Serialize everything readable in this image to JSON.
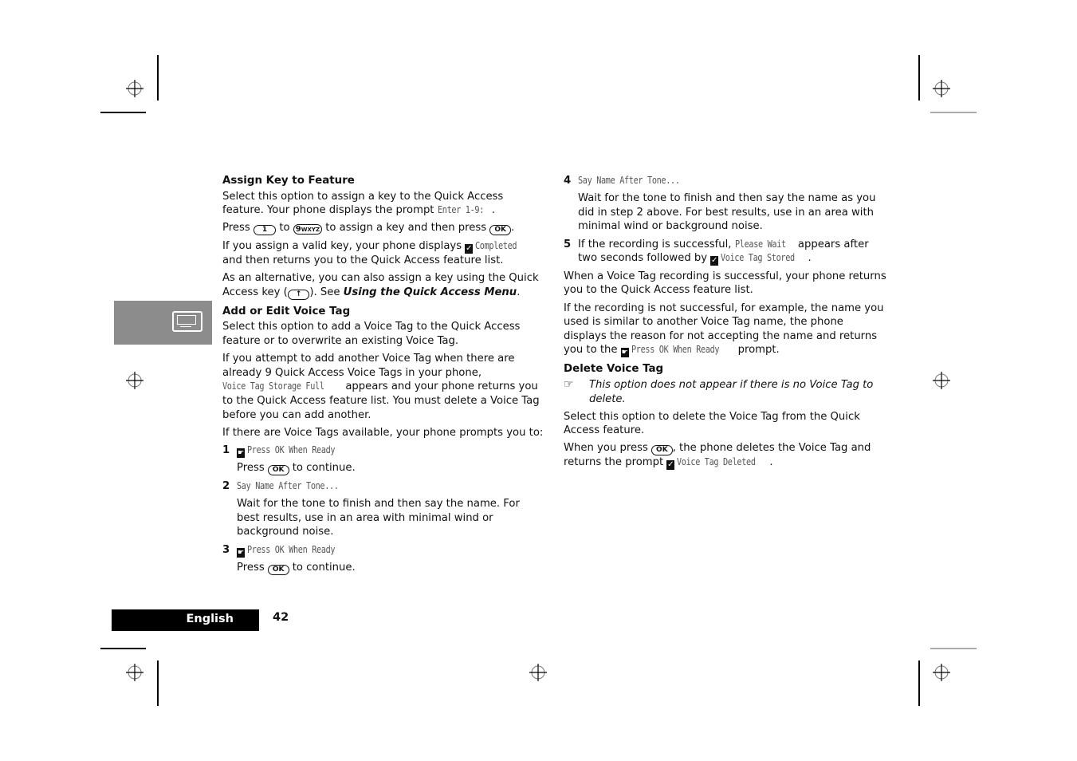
{
  "left_column": {
    "assign_key": {
      "heading": "Assign Key to Feature",
      "p1_text": "Select this option to assign a key to the Quick Access feature. Your phone displays the prompt ",
      "p1_lcd": "Enter 1-9:",
      "p1_end": ".",
      "p2_press": "Press ",
      "p2_key1": "1",
      "p2_to": " to ",
      "p2_key2_num": "9",
      "p2_key2_letters": "WXYZ",
      "p2_mid": " to assign a key and then press ",
      "p2_key3": "OK",
      "p2_end": ".",
      "p3_text": "If you assign a valid key, your phone displays ",
      "p3_lcd": "Completed",
      "p3_end": " and then returns you to the Quick Access feature list.",
      "p4_text": "As an alternative, you can also assign a key using the Quick Access key (",
      "p4_key": "↑",
      "p4_mid": "). See ",
      "p4_link": "Using the Quick Access Menu",
      "p4_end": "."
    },
    "add_edit": {
      "heading": "Add or Edit Voice Tag",
      "p1": "Select this option to add a Voice Tag to the Quick Access feature or to overwrite an existing Voice Tag.",
      "p2_text": "If you attempt to add another Voice Tag when there are already 9 Quick Access Voice Tags in your phone, ",
      "p2_lcd": "Voice Tag Storage Full",
      "p2_end": " appears and your phone returns you to the Quick Access feature list. You must delete a Voice Tag before you can add another.",
      "p3": "If there are Voice Tags available, your phone prompts you to:",
      "steps": [
        {
          "num": "1",
          "lcd": "Press OK When Ready",
          "body_press": "Press ",
          "body_key": "OK",
          "body_end": " to continue."
        },
        {
          "num": "2",
          "lcd": "Say Name After Tone...",
          "body": "Wait for the tone to finish and then say the name. For best results, use in an area with minimal wind or background noise."
        },
        {
          "num": "3",
          "lcd": "Press OK When Ready",
          "body_press": "Press ",
          "body_key": "OK",
          "body_end": " to continue."
        }
      ]
    }
  },
  "right_column": {
    "steps": [
      {
        "num": "4",
        "lcd": "Say Name After Tone...",
        "body": "Wait for the tone to finish and then say the name as you did in step 2 above. For best results, use in an area with minimal wind or background noise."
      },
      {
        "num": "5",
        "text1": "If the recording is successful, ",
        "lcd1": "Please Wait",
        "text2": " appears after two seconds followed by ",
        "lcd2": "Voice Tag Stored",
        "text3": "."
      }
    ],
    "p_success": "When a Voice Tag recording is successful, your phone returns you to the Quick Access feature list.",
    "p_fail_text": "If the recording is not successful, for example, the name you used is similar to another Voice Tag name, the phone displays the reason for not accepting the name and returns you to the ",
    "p_fail_lcd": "Press OK When Ready",
    "p_fail_end": " prompt.",
    "delete": {
      "heading": "Delete Voice Tag",
      "note_icon": "☞",
      "note": "This option does not appear if there is no Voice Tag to delete.",
      "p1": "Select this option to delete the Voice Tag from the Quick Access feature.",
      "p2_text": "When you press ",
      "p2_key": "OK",
      "p2_mid": ", the phone deletes the Voice Tag and returns the prompt ",
      "p2_lcd": "Voice Tag Deleted",
      "p2_end": "."
    }
  },
  "side_tab": {
    "icon": "cassette-icon",
    "color": "#8c8c8c"
  },
  "footer": {
    "language": "English",
    "page_number": "42"
  },
  "icons": {
    "check": "✓",
    "pointer": "☛"
  }
}
